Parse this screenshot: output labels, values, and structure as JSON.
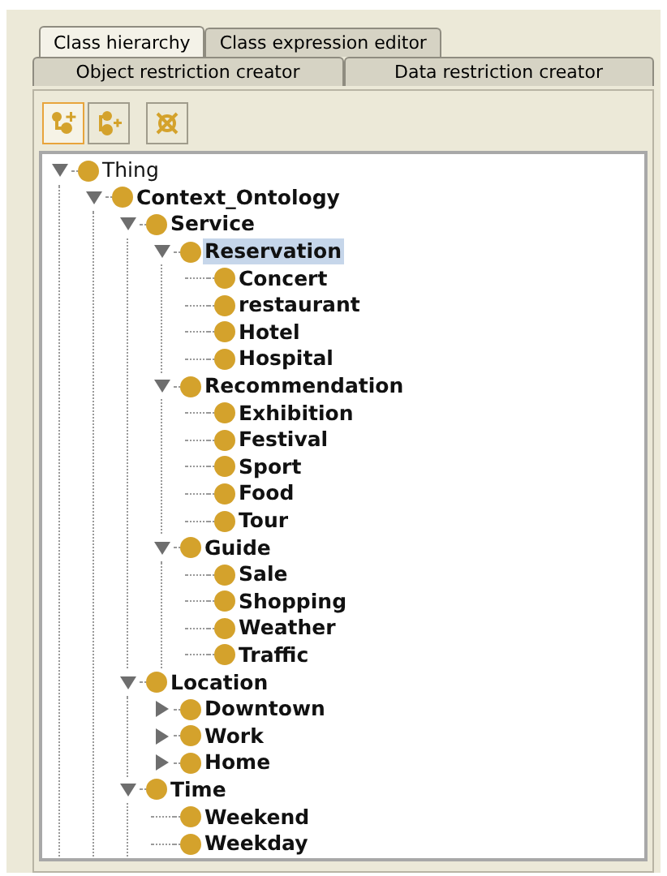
{
  "tabs_row_1": [
    {
      "label": "Class hierarchy",
      "selected": true
    },
    {
      "label": "Class expression editor",
      "selected": false
    }
  ],
  "tabs_row_2": [
    {
      "label": "Object restriction creator",
      "selected": false
    },
    {
      "label": "Data restriction creator",
      "selected": false
    }
  ],
  "toolbar": [
    {
      "kind": "add-subclass",
      "selected": true
    },
    {
      "kind": "add-sibling",
      "selected": false
    },
    {
      "kind": "delete",
      "selected": false
    }
  ],
  "tree": [
    {
      "label": "Thing",
      "bold": false,
      "selected": false,
      "expanded": true,
      "children": [
        {
          "label": "Context_Ontology",
          "bold": true,
          "selected": false,
          "expanded": true,
          "children": [
            {
              "label": "Service",
              "bold": true,
              "selected": false,
              "expanded": true,
              "children": [
                {
                  "label": "Reservation",
                  "bold": true,
                  "selected": true,
                  "expanded": true,
                  "children": [
                    {
                      "label": "Concert",
                      "bold": true,
                      "selected": false
                    },
                    {
                      "label": "restaurant",
                      "bold": true,
                      "selected": false
                    },
                    {
                      "label": "Hotel",
                      "bold": true,
                      "selected": false
                    },
                    {
                      "label": "Hospital",
                      "bold": true,
                      "selected": false
                    }
                  ]
                },
                {
                  "label": "Recommendation",
                  "bold": true,
                  "selected": false,
                  "expanded": true,
                  "children": [
                    {
                      "label": "Exhibition",
                      "bold": true,
                      "selected": false
                    },
                    {
                      "label": "Festival",
                      "bold": true,
                      "selected": false
                    },
                    {
                      "label": "Sport",
                      "bold": true,
                      "selected": false
                    },
                    {
                      "label": "Food",
                      "bold": true,
                      "selected": false
                    },
                    {
                      "label": "Tour",
                      "bold": true,
                      "selected": false
                    }
                  ]
                },
                {
                  "label": "Guide",
                  "bold": true,
                  "selected": false,
                  "expanded": true,
                  "children": [
                    {
                      "label": "Sale",
                      "bold": true,
                      "selected": false
                    },
                    {
                      "label": "Shopping",
                      "bold": true,
                      "selected": false
                    },
                    {
                      "label": "Weather",
                      "bold": true,
                      "selected": false
                    },
                    {
                      "label": "Traffic",
                      "bold": true,
                      "selected": false
                    }
                  ]
                }
              ]
            },
            {
              "label": "Location",
              "bold": true,
              "selected": false,
              "expanded": true,
              "children": [
                {
                  "label": "Downtown",
                  "bold": true,
                  "selected": false,
                  "expanded": false
                },
                {
                  "label": "Work",
                  "bold": true,
                  "selected": false,
                  "expanded": false
                },
                {
                  "label": "Home",
                  "bold": true,
                  "selected": false,
                  "expanded": false
                }
              ]
            },
            {
              "label": "Time",
              "bold": true,
              "selected": false,
              "expanded": true,
              "children": [
                {
                  "label": "Weekend",
                  "bold": true,
                  "selected": false
                },
                {
                  "label": "Weekday",
                  "bold": true,
                  "selected": false
                }
              ]
            }
          ]
        }
      ]
    }
  ]
}
